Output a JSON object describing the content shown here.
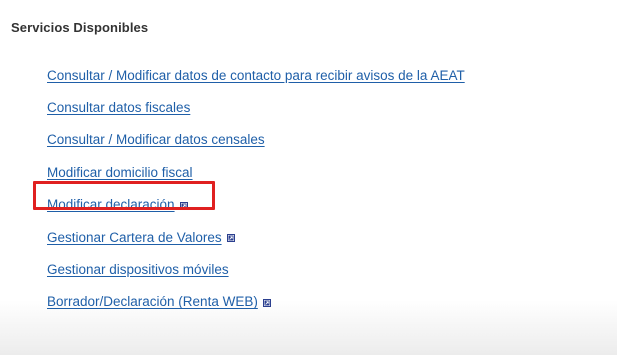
{
  "section": {
    "title": "Servicios Disponibles"
  },
  "services": [
    {
      "label": "Consultar / Modificar datos de contacto para recibir avisos de la AEAT",
      "external": false
    },
    {
      "label": "Consultar datos fiscales",
      "external": false
    },
    {
      "label": "Consultar / Modificar datos censales",
      "external": false
    },
    {
      "label": "Modificar domicilio fiscal",
      "external": false
    },
    {
      "label": "Modificar declaración",
      "external": true
    },
    {
      "label": "Gestionar Cartera de Valores",
      "external": true
    },
    {
      "label": "Gestionar dispositivos móviles",
      "external": false
    },
    {
      "label": "Borrador/Declaración (Renta WEB)",
      "external": true
    }
  ],
  "colors": {
    "link": "#1f5fa8",
    "highlight": "#e02020",
    "external_icon": "#2b3f8f"
  },
  "icons": {
    "external": "external-window-icon"
  }
}
